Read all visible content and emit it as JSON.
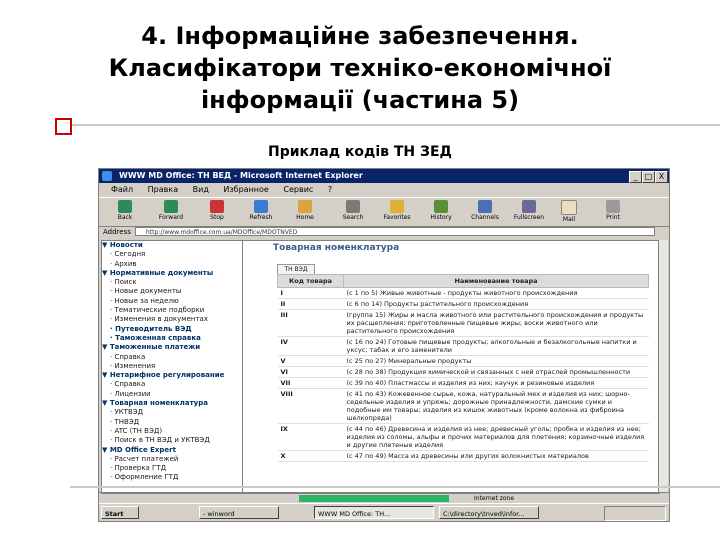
{
  "slide": {
    "title_lines": [
      "4. Інформаційне забезпечення.",
      "Класифікатори техніко-економічної",
      "інформації (частина 5)"
    ],
    "subtitle": "Приклад кодів ТН ЗЕД"
  },
  "browser": {
    "window_title": "WWW MD Office: TH ВЕД - Microsoft Internet Explorer",
    "window_buttons": [
      "_",
      "□",
      "X"
    ],
    "menu": [
      "Файл",
      "Правка",
      "Вид",
      "Избранное",
      "Сервис",
      "?"
    ],
    "toolbar": [
      {
        "label": "Back",
        "icon": "back-arrow-icon"
      },
      {
        "label": "Forward",
        "icon": "forward-arrow-icon"
      },
      {
        "label": "Stop",
        "icon": "stop-icon"
      },
      {
        "label": "Refresh",
        "icon": "refresh-icon"
      },
      {
        "label": "Home",
        "icon": "home-icon"
      },
      {
        "label": "Search",
        "icon": "search-icon"
      },
      {
        "label": "Favorites",
        "icon": "favorites-icon"
      },
      {
        "label": "History",
        "icon": "history-icon"
      },
      {
        "label": "Channels",
        "icon": "channels-icon"
      },
      {
        "label": "Fullscreen",
        "icon": "fullscreen-icon"
      },
      {
        "label": "Mail",
        "icon": "mail-icon"
      },
      {
        "label": "Print",
        "icon": "print-icon"
      }
    ],
    "address_label": "Address",
    "address_value": "http://www.mdoffice.com.ua/MDOffice/MDOTNVED",
    "status_zone": "Internet zone"
  },
  "nav": [
    {
      "text": "Новости",
      "kind": "h"
    },
    {
      "text": "Сегодня",
      "kind": "i"
    },
    {
      "text": "Архив",
      "kind": "i"
    },
    {
      "text": "Нормативные документы",
      "kind": "h"
    },
    {
      "text": "Поиск",
      "kind": "i"
    },
    {
      "text": "Новые документы",
      "kind": "i"
    },
    {
      "text": "Новые за неделю",
      "kind": "i"
    },
    {
      "text": "Тематические подборки",
      "kind": "i"
    },
    {
      "text": "Изменения в документах",
      "kind": "i"
    },
    {
      "text": "Путеводитель ВЭД",
      "kind": "b"
    },
    {
      "text": "Таможенная справка",
      "kind": "b"
    },
    {
      "text": "Таможенные платежи",
      "kind": "h"
    },
    {
      "text": "Справка",
      "kind": "i"
    },
    {
      "text": "Изменения",
      "kind": "i"
    },
    {
      "text": "Нетарифное регулирование",
      "kind": "h"
    },
    {
      "text": "Справка",
      "kind": "i"
    },
    {
      "text": "Лицензии",
      "kind": "i"
    },
    {
      "text": "Товарная номенклатура",
      "kind": "h"
    },
    {
      "text": "УКТВЭД",
      "kind": "i"
    },
    {
      "text": "ТНВЭД",
      "kind": "i"
    },
    {
      "text": "ATC (TH ВЭД)",
      "kind": "i"
    },
    {
      "text": "Поиск в ТН ВЭД и УКТВЭД",
      "kind": "i"
    },
    {
      "text": "MD Office Expert",
      "kind": "h"
    },
    {
      "text": "Расчет платежей",
      "kind": "i"
    },
    {
      "text": "Проверка ГТД",
      "kind": "i"
    },
    {
      "text": "Оформление ГТД",
      "kind": "i"
    }
  ],
  "content": {
    "heading": "Товарная номенклатура",
    "tab": "ТН ВЭД",
    "col_code": "Код товара",
    "col_name": "Наименование товара",
    "rows": [
      {
        "code": "I",
        "name": "(с 1 по 5) Живые животные - продукты животного происхождения"
      },
      {
        "code": "II",
        "name": "(с 6 по 14) Продукты растительного происхождения"
      },
      {
        "code": "III",
        "name": "(группа 15) Жиры и масла животного или растительного происхождения и продукты их расщепления; приготовленные пищевые жиры; воски животного или растительного происхождения"
      },
      {
        "code": "IV",
        "name": "(с 16 по 24) Готовые пищевые продукты; алкогольные и безалкогольные напитки и уксус; табак и его заменители"
      },
      {
        "code": "V",
        "name": "(с 25 по 27) Минеральные продукты"
      },
      {
        "code": "VI",
        "name": "(с 28 по 38) Продукция химической и связанных с ней отраслей промышленности"
      },
      {
        "code": "VII",
        "name": "(с 39 по 40) Пластмассы и изделия из них; каучук и резиновые изделия"
      },
      {
        "code": "VIII",
        "name": "(с 41 по 43) Кожевенное сырье, кожа, натуральный мех и изделия из них; шорно-седельные изделия и упряжь; дорожные принадлежности, дамские сумки и подобные им товары; изделия из кишок животных (кроме волокна из фиброина шелкопряда)"
      },
      {
        "code": "IX",
        "name": "(с 44 по 46) Древесина и изделия из нее; древесный уголь; пробка и изделия из нее; изделия из соломы, альфы и прочих материалов для плетения; корзиночные изделия и другие плетеные изделия"
      },
      {
        "code": "X",
        "name": "(с 47 по 49) Масса из древесины или других волокнистых материалов"
      }
    ]
  },
  "taskbar": {
    "start": "Start",
    "tasks": [
      "- winword",
      "WWW MD Office: TH...",
      "C:\\directory\\tnved\\infor..."
    ]
  }
}
